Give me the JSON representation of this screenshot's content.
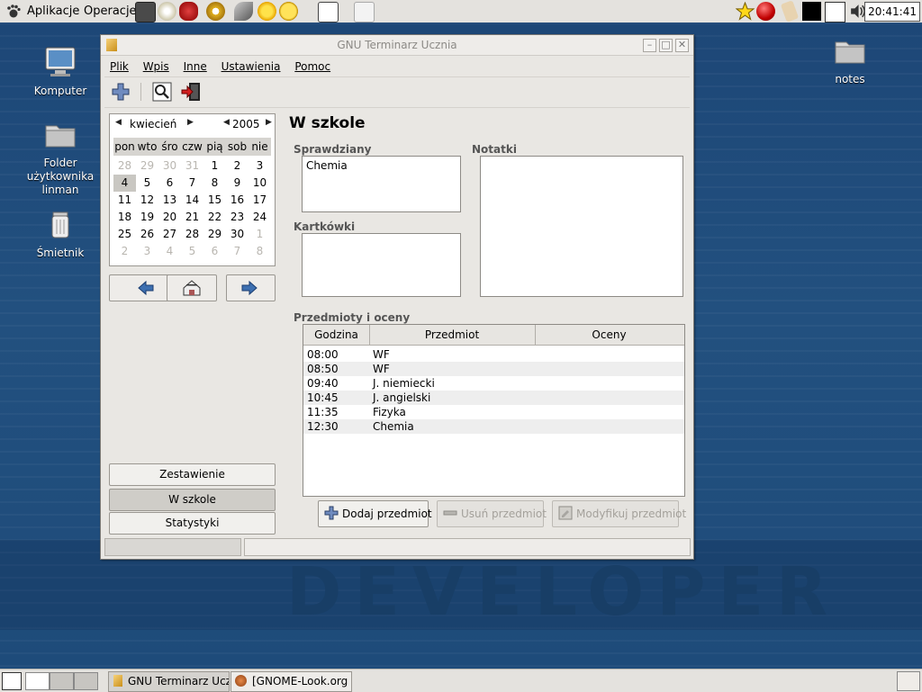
{
  "top_panel": {
    "applications": "Aplikacje",
    "operations": "Operacje",
    "clock": "20:41:41"
  },
  "desktop_icons": [
    {
      "label": "Komputer"
    },
    {
      "label": "Folder\nużytkownika\nlinman"
    },
    {
      "label": "Śmietnik"
    },
    {
      "label": "notes"
    }
  ],
  "window": {
    "title": "GNU Terminarz Ucznia",
    "menu": [
      "Plik",
      "Wpis",
      "Inne",
      "Ustawienia",
      "Pomoc"
    ],
    "calendar": {
      "month": "kwiecień",
      "year": "2005",
      "weekdays": [
        "pon",
        "wto",
        "śro",
        "czw",
        "pią",
        "sob",
        "nie"
      ],
      "weeks": [
        [
          "28",
          "29",
          "30",
          "31",
          "1",
          "2",
          "3"
        ],
        [
          "4",
          "5",
          "6",
          "7",
          "8",
          "9",
          "10"
        ],
        [
          "11",
          "12",
          "13",
          "14",
          "15",
          "16",
          "17"
        ],
        [
          "18",
          "19",
          "20",
          "21",
          "22",
          "23",
          "24"
        ],
        [
          "25",
          "26",
          "27",
          "28",
          "29",
          "30",
          "1"
        ],
        [
          "2",
          "3",
          "4",
          "5",
          "6",
          "7",
          "8"
        ]
      ],
      "selected_day": "4"
    },
    "side_buttons": [
      "Zestawienie",
      "W szkole",
      "Statystyki"
    ],
    "active_side_button": "W szkole",
    "heading": "W szkole",
    "tests_label": "Sprawdziany",
    "tests_text": "Chemia",
    "quizzes_label": "Kartkówki",
    "quizzes_text": "",
    "notes_label": "Notatki",
    "notes_text": "",
    "subjects_label": "Przedmioty i oceny",
    "table": {
      "columns": [
        "Godzina",
        "Przedmiot",
        "Oceny"
      ],
      "rows": [
        {
          "time": "08:00",
          "subject": "WF",
          "grades": ""
        },
        {
          "time": "08:50",
          "subject": "WF",
          "grades": ""
        },
        {
          "time": "09:40",
          "subject": "J. niemiecki",
          "grades": ""
        },
        {
          "time": "10:45",
          "subject": "J. angielski",
          "grades": ""
        },
        {
          "time": "11:35",
          "subject": "Fizyka",
          "grades": ""
        },
        {
          "time": "12:30",
          "subject": "Chemia",
          "grades": ""
        }
      ]
    },
    "actions": {
      "add": "Dodaj przedmiot",
      "remove": "Usuń przedmiot",
      "modify": "Modyfikuj przedmiot"
    }
  },
  "taskbar": {
    "tasks": [
      "GNU Terminarz Ucz",
      "[GNOME-Look.org -"
    ]
  },
  "wallpaper_text": "DEVELOPER"
}
